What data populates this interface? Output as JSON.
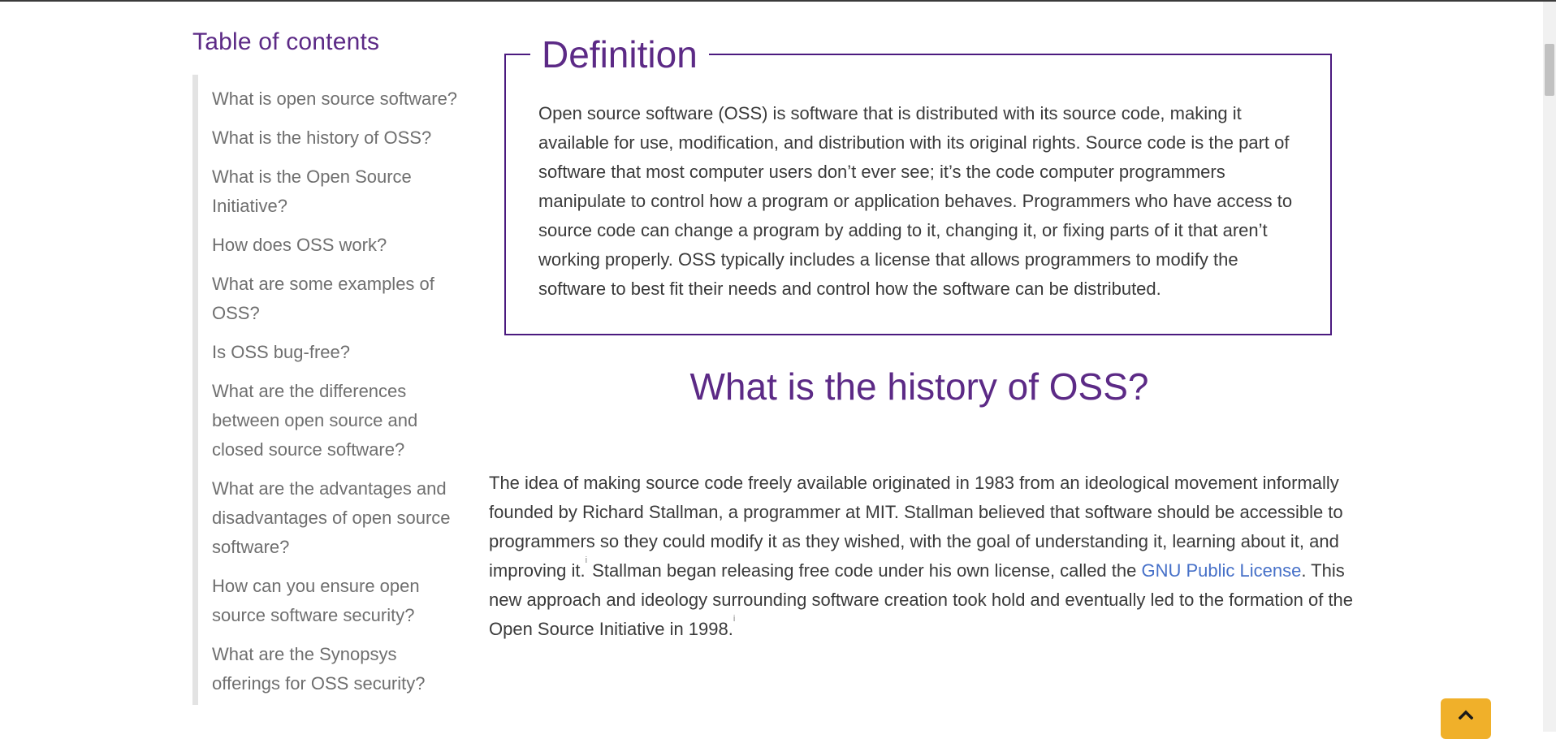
{
  "toc": {
    "title": "Table of contents",
    "items": [
      "What is open source software?",
      "What is the history of OSS?",
      "What is the Open Source Initiative?",
      "How does OSS work?",
      "What are some examples of OSS?",
      "Is OSS bug-free?",
      "What are the differences between open source and closed source software?",
      "What are the advantages and disadvantages of open source software?",
      "How can you ensure open source software security?",
      "What are the Synopsys offerings for OSS security?"
    ]
  },
  "definition": {
    "title": "Definition",
    "text": "Open source software (OSS) is software that is distributed with its source code, making it available for use, modification, and distribution with its original rights. Source code is the part of software that most computer users don’t ever see; it’s the code computer programmers manipulate to control how a program or application behaves. Programmers who have access to source code can change a program by adding to it, changing it, or fixing parts of it that aren’t working properly. OSS typically includes a license that allows programmers to modify the software to best fit their needs and control how the software can be distributed."
  },
  "history": {
    "heading": "What is the history of OSS?",
    "para_part1": "The idea of making source code freely available originated in 1983 from an ideological movement informally founded by Richard Stallman, a programmer at MIT. Stallman believed that software should be accessible to programmers so they could modify it as they wished, with the goal of understanding it, learning about it, and improving it.",
    "sup1": "i",
    "para_part2": " Stallman began releasing free code under his own license, called the ",
    "link_text": "GNU Public License",
    "para_part3": ". This new approach and ideology surrounding software creation took hold and eventually led to the formation of the Open Source Initiative in 1998.",
    "sup2": "i"
  },
  "colors": {
    "accent_purple": "#5c2a86",
    "link_blue": "#4670c8",
    "back_to_top": "#f0b02a"
  },
  "icons": {
    "back_to_top": "chevron-up-icon"
  }
}
